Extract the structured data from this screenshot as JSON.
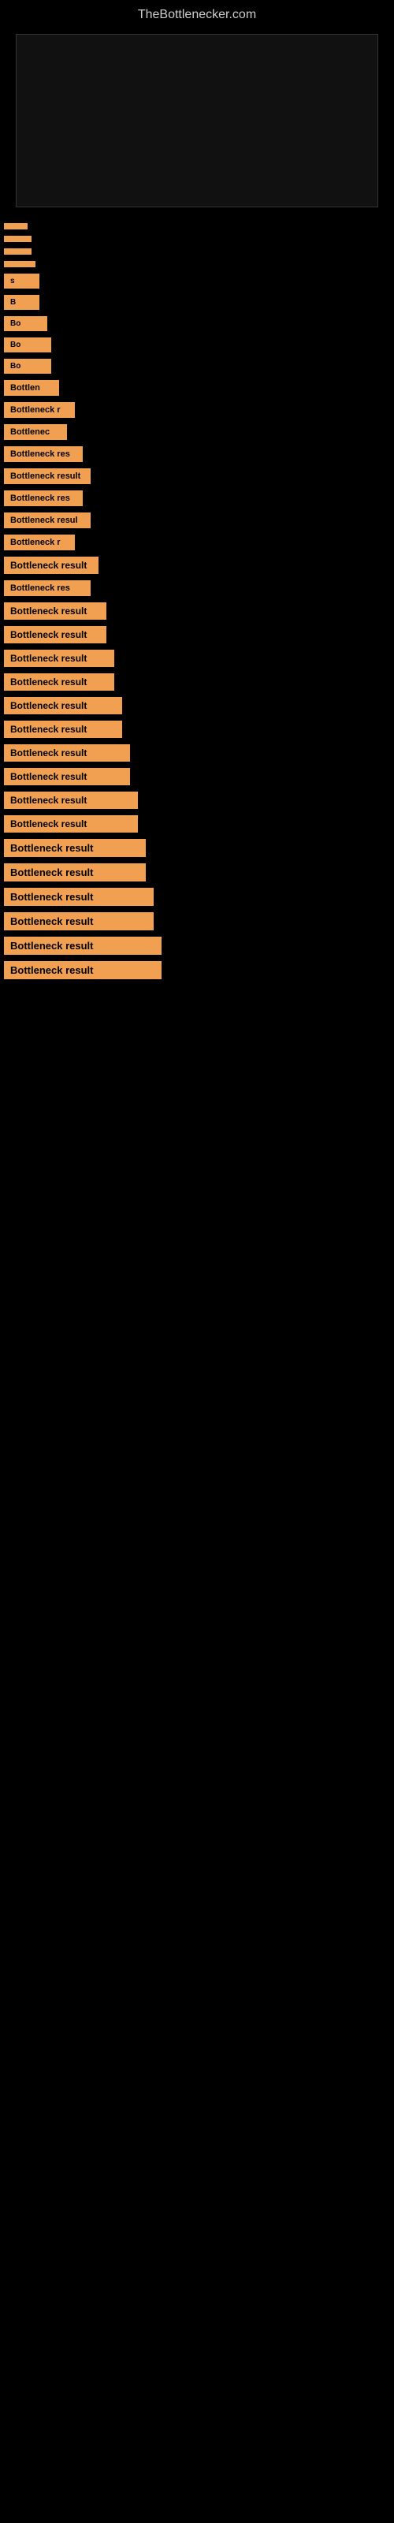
{
  "site": {
    "title": "TheBottlenecker.com"
  },
  "results": [
    {
      "id": 1,
      "label": "",
      "width_class": "bar-w1"
    },
    {
      "id": 2,
      "label": "",
      "width_class": "bar-w2"
    },
    {
      "id": 3,
      "label": "",
      "width_class": "bar-w2"
    },
    {
      "id": 4,
      "label": "",
      "width_class": "bar-w3"
    },
    {
      "id": 5,
      "label": "s",
      "width_class": "bar-w4"
    },
    {
      "id": 6,
      "label": "B",
      "width_class": "bar-w4"
    },
    {
      "id": 7,
      "label": "Bo",
      "width_class": "bar-w5"
    },
    {
      "id": 8,
      "label": "Bo",
      "width_class": "bar-w6"
    },
    {
      "id": 9,
      "label": "Bo",
      "width_class": "bar-w6"
    },
    {
      "id": 10,
      "label": "Bottlen",
      "width_class": "bar-w7"
    },
    {
      "id": 11,
      "label": "Bottleneck r",
      "width_class": "bar-w9"
    },
    {
      "id": 12,
      "label": "Bottlenec",
      "width_class": "bar-w8"
    },
    {
      "id": 13,
      "label": "Bottleneck res",
      "width_class": "bar-w10"
    },
    {
      "id": 14,
      "label": "Bottleneck result",
      "width_class": "bar-w11"
    },
    {
      "id": 15,
      "label": "Bottleneck res",
      "width_class": "bar-w10"
    },
    {
      "id": 16,
      "label": "Bottleneck resul",
      "width_class": "bar-w11"
    },
    {
      "id": 17,
      "label": "Bottleneck r",
      "width_class": "bar-w9"
    },
    {
      "id": 18,
      "label": "Bottleneck result",
      "width_class": "bar-w12"
    },
    {
      "id": 19,
      "label": "Bottleneck res",
      "width_class": "bar-w11"
    },
    {
      "id": 20,
      "label": "Bottleneck result",
      "width_class": "bar-w13"
    },
    {
      "id": 21,
      "label": "Bottleneck result",
      "width_class": "bar-w13"
    },
    {
      "id": 22,
      "label": "Bottleneck result",
      "width_class": "bar-w14"
    },
    {
      "id": 23,
      "label": "Bottleneck result",
      "width_class": "bar-w14"
    },
    {
      "id": 24,
      "label": "Bottleneck result",
      "width_class": "bar-w15"
    },
    {
      "id": 25,
      "label": "Bottleneck result",
      "width_class": "bar-w15"
    },
    {
      "id": 26,
      "label": "Bottleneck result",
      "width_class": "bar-w16"
    },
    {
      "id": 27,
      "label": "Bottleneck result",
      "width_class": "bar-w16"
    },
    {
      "id": 28,
      "label": "Bottleneck result",
      "width_class": "bar-w17"
    },
    {
      "id": 29,
      "label": "Bottleneck result",
      "width_class": "bar-w17"
    },
    {
      "id": 30,
      "label": "Bottleneck result",
      "width_class": "bar-w18"
    },
    {
      "id": 31,
      "label": "Bottleneck result",
      "width_class": "bar-w18"
    },
    {
      "id": 32,
      "label": "Bottleneck result",
      "width_class": "bar-w19"
    },
    {
      "id": 33,
      "label": "Bottleneck result",
      "width_class": "bar-w19"
    },
    {
      "id": 34,
      "label": "Bottleneck result",
      "width_class": "bar-w20"
    },
    {
      "id": 35,
      "label": "Bottleneck result",
      "width_class": "bar-w20"
    }
  ]
}
